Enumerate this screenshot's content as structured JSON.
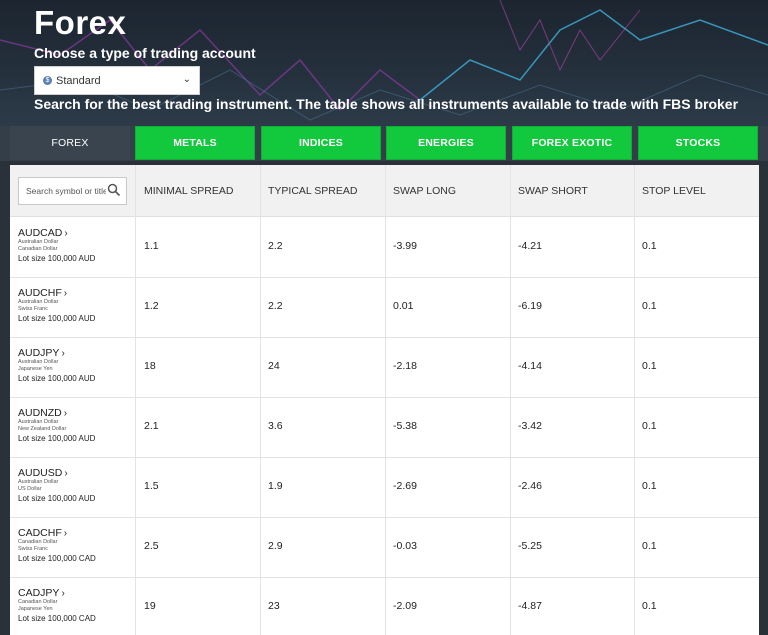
{
  "header": {
    "title": "Forex",
    "choose_label": "Choose a type of trading account",
    "account_type": {
      "selected": "Standard",
      "icon": "dollar-coin-icon"
    },
    "description": "Search for the best trading instrument. The table shows all instruments available to trade with FBS broker"
  },
  "tabs": [
    {
      "label": "FOREX",
      "active": true
    },
    {
      "label": "METALS",
      "active": false
    },
    {
      "label": "INDICES",
      "active": false
    },
    {
      "label": "ENERGIES",
      "active": false
    },
    {
      "label": "FOREX EXOTIC",
      "active": false
    },
    {
      "label": "STOCKS",
      "active": false
    }
  ],
  "table": {
    "search_placeholder": "Search symbol or title",
    "columns": [
      "MINIMAL SPREAD",
      "TYPICAL SPREAD",
      "SWAP LONG",
      "SWAP SHORT",
      "STOP LEVEL"
    ],
    "rows": [
      {
        "symbol": "AUDCAD",
        "base": "Australian Dollar",
        "quote": "Canadian Dollar",
        "lot": "Lot size 100,000 AUD",
        "min_spread": "1.1",
        "typical_spread": "2.2",
        "swap_long": "-3.99",
        "swap_short": "-4.21",
        "stop_level": "0.1"
      },
      {
        "symbol": "AUDCHF",
        "base": "Australian Dollar",
        "quote": "Swiss Franc",
        "lot": "Lot size 100,000 AUD",
        "min_spread": "1.2",
        "typical_spread": "2.2",
        "swap_long": "0.01",
        "swap_short": "-6.19",
        "stop_level": "0.1"
      },
      {
        "symbol": "AUDJPY",
        "base": "Australian Dollar",
        "quote": "Japanese Yen",
        "lot": "Lot size 100,000 AUD",
        "min_spread": "18",
        "typical_spread": "24",
        "swap_long": "-2.18",
        "swap_short": "-4.14",
        "stop_level": "0.1"
      },
      {
        "symbol": "AUDNZD",
        "base": "Australian Dollar",
        "quote": "New Zealand Dollar",
        "lot": "Lot size 100,000 AUD",
        "min_spread": "2.1",
        "typical_spread": "3.6",
        "swap_long": "-5.38",
        "swap_short": "-3.42",
        "stop_level": "0.1"
      },
      {
        "symbol": "AUDUSD",
        "base": "Australian Dollar",
        "quote": "US Dollar",
        "lot": "Lot size 100,000 AUD",
        "min_spread": "1.5",
        "typical_spread": "1.9",
        "swap_long": "-2.69",
        "swap_short": "-2.46",
        "stop_level": "0.1"
      },
      {
        "symbol": "CADCHF",
        "base": "Canadian Dollar",
        "quote": "Swiss Franc",
        "lot": "Lot size 100,000 CAD",
        "min_spread": "2.5",
        "typical_spread": "2.9",
        "swap_long": "-0.03",
        "swap_short": "-5.25",
        "stop_level": "0.1"
      },
      {
        "symbol": "CADJPY",
        "base": "Canadian Dollar",
        "quote": "Japanese Yen",
        "lot": "Lot size 100,000 CAD",
        "min_spread": "19",
        "typical_spread": "23",
        "swap_long": "-2.09",
        "swap_short": "-4.87",
        "stop_level": "0.1"
      }
    ]
  },
  "colors": {
    "tab_green": "#12c93d",
    "tab_active": "#3a444e",
    "hero_bg": "#1c2530"
  }
}
